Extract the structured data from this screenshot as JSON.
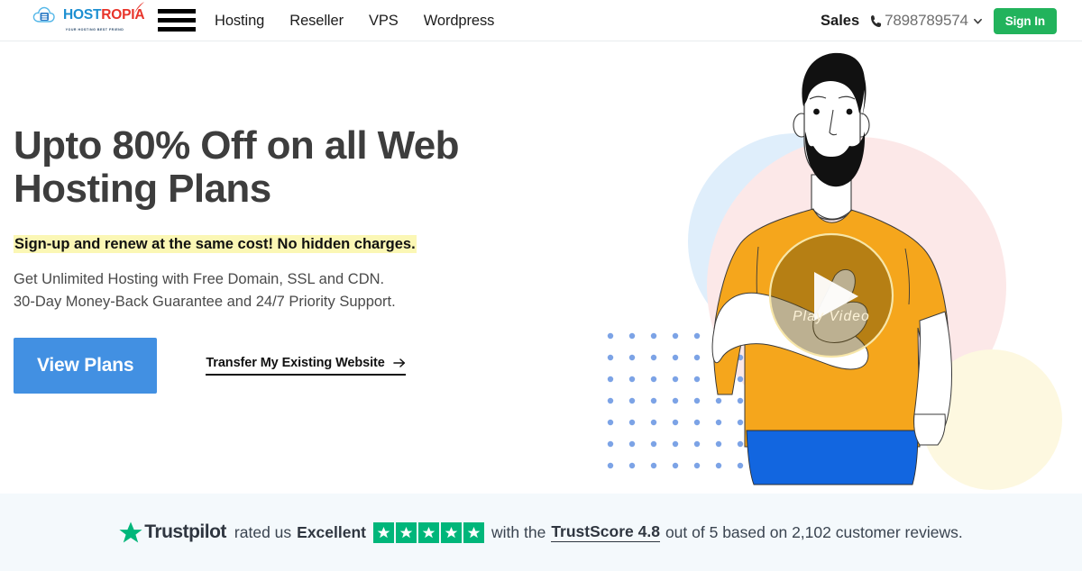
{
  "header": {
    "logo": {
      "text_primary": "HOST",
      "text_secondary": "ROPIA",
      "tagline": "YOUR HOSTING BEST FRIEND",
      "icon": "cloud-server-icon"
    },
    "menu_icon": "hamburger-menu-icon",
    "nav": [
      {
        "label": "Hosting"
      },
      {
        "label": "Reseller"
      },
      {
        "label": "VPS"
      },
      {
        "label": "Wordpress"
      }
    ],
    "sales_label": "Sales",
    "phone_icon": "phone-icon",
    "phone_number": "7898789574",
    "phone_chevron": "chevron-down-icon",
    "sign_in_label": "Sign In",
    "sign_in_color": "#22b35c"
  },
  "hero": {
    "headline": "Upto 80% Off on all Web Hosting Plans",
    "highlight": "Sign-up and renew at the same cost! No hidden charges.",
    "highlight_color": "#fbf7b5",
    "description_line1": "Get Unlimited Hosting with Free Domain, SSL and CDN.",
    "description_line2": "30-Day Money-Back Guarantee and 24/7 Priority Support.",
    "primary_button": "View Plans",
    "primary_button_color": "#4290e2",
    "secondary_link": "Transfer My Existing Website",
    "secondary_link_icon": "arrow-right-icon",
    "video": {
      "play_label": "Play Video",
      "play_icon": "play-triangle-icon"
    },
    "illustration": {
      "name": "bearded-man-thumbs-up-illustration",
      "shirt_color": "#f5a61c",
      "shorts_color": "#1266e0",
      "blue_circle_color": "#dfeefb",
      "pink_circle_color": "#fce8e8",
      "yellow_circle_color": "#fdf8e0",
      "dot_color": "#7ca3e6"
    }
  },
  "trustpilot": {
    "brand": "Trustpilot",
    "star_icon": "trustpilot-star-icon",
    "rated_text": "rated us",
    "rating_word": "Excellent",
    "stars_count": 5,
    "star_color": "#00b67a",
    "with_the_text": "with the",
    "trustscore_label": "TrustScore 4.8",
    "out_of_text": "out of 5 based on 2,102 customer reviews.",
    "background": "#f4f9fc"
  }
}
